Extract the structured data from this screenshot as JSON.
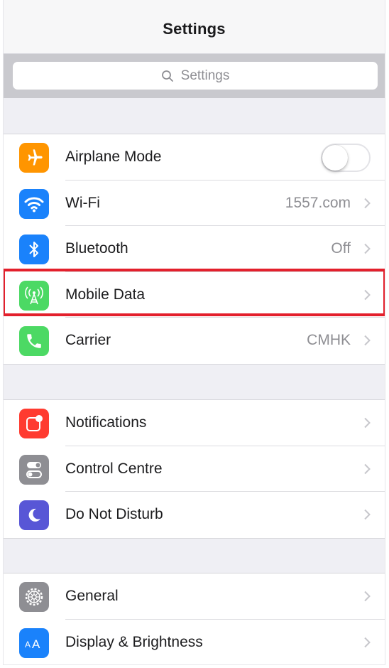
{
  "navbar": {
    "title": "Settings"
  },
  "search": {
    "placeholder": "Settings",
    "icon": "search-icon"
  },
  "groups": [
    {
      "rows": [
        {
          "label": "Airplane Mode",
          "icon": "airplane-icon",
          "color": "#ff9500",
          "control": "toggle",
          "toggle_on": false
        },
        {
          "label": "Wi-Fi",
          "icon": "wifi-icon",
          "color": "#1a82fb",
          "value": "1557.com"
        },
        {
          "label": "Bluetooth",
          "icon": "bluetooth-icon",
          "color": "#1a82fb",
          "value": "Off"
        },
        {
          "label": "Mobile Data",
          "icon": "antenna-icon",
          "color": "#4cd964",
          "value": "",
          "highlighted": true
        },
        {
          "label": "Carrier",
          "icon": "phone-icon",
          "color": "#4cd964",
          "value": "CMHK"
        }
      ]
    },
    {
      "rows": [
        {
          "label": "Notifications",
          "icon": "notifications-icon",
          "color": "#ff3b30"
        },
        {
          "label": "Control Centre",
          "icon": "control-centre-icon",
          "color": "#8e8e93"
        },
        {
          "label": "Do Not Disturb",
          "icon": "moon-icon",
          "color": "#5856d6"
        }
      ]
    },
    {
      "rows": [
        {
          "label": "General",
          "icon": "gear-icon",
          "color": "#8e8e93"
        },
        {
          "label": "Display & Brightness",
          "icon": "display-brightness-icon",
          "color": "#1a82fb"
        }
      ]
    }
  ],
  "highlight_color": "#e3202c"
}
